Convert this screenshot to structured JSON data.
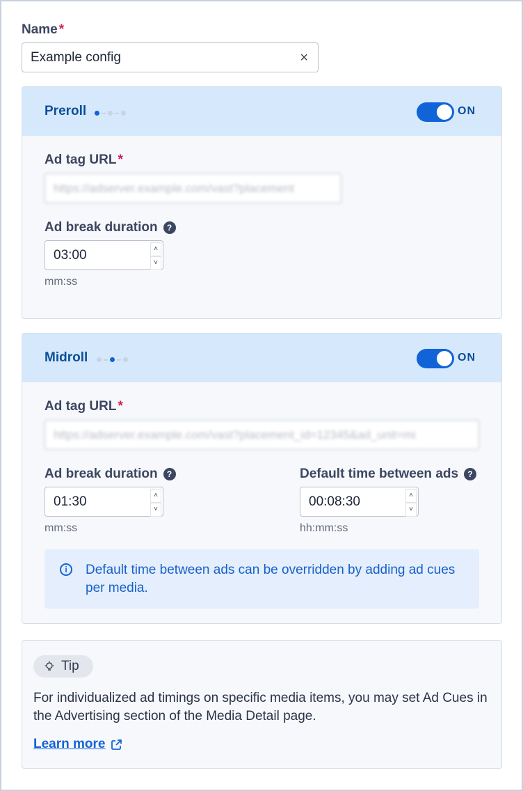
{
  "name_field": {
    "label": "Name",
    "required_mark": "*",
    "value": "Example config",
    "clear_symbol": "×"
  },
  "preroll": {
    "title": "Preroll",
    "toggle_state": "ON",
    "ad_tag": {
      "label": "Ad tag URL",
      "required_mark": "*",
      "value": "https://adserver.example.com/vast?placement"
    },
    "duration": {
      "label": "Ad break duration",
      "help_symbol": "?",
      "value": "03:00",
      "hint": "mm:ss"
    }
  },
  "midroll": {
    "title": "Midroll",
    "toggle_state": "ON",
    "ad_tag": {
      "label": "Ad tag URL",
      "required_mark": "*",
      "value": "https://adserver.example.com/vast?placement_id=12345&ad_unit=mi"
    },
    "duration": {
      "label": "Ad break duration",
      "help_symbol": "?",
      "value": "01:30",
      "hint": "mm:ss"
    },
    "between": {
      "label": "Default time between ads",
      "help_symbol": "?",
      "value": "00:08:30",
      "hint": "hh:mm:ss"
    },
    "info": {
      "icon_symbol": "i",
      "text": "Default time between ads can be overridden by adding ad cues per media."
    }
  },
  "tip": {
    "badge": "Tip",
    "text": "For individualized ad timings on specific media items, you may set Ad Cues in the Advertising section of the Media Detail page.",
    "link": "Learn more"
  },
  "colors": {
    "accent": "#1163d8",
    "header_bg": "#d6e8fb",
    "required": "#d31d4f"
  },
  "icons": {
    "clear": "close-icon",
    "help": "help-icon",
    "info": "info-icon",
    "tip": "lightbulb-icon",
    "external": "external-link-icon"
  }
}
